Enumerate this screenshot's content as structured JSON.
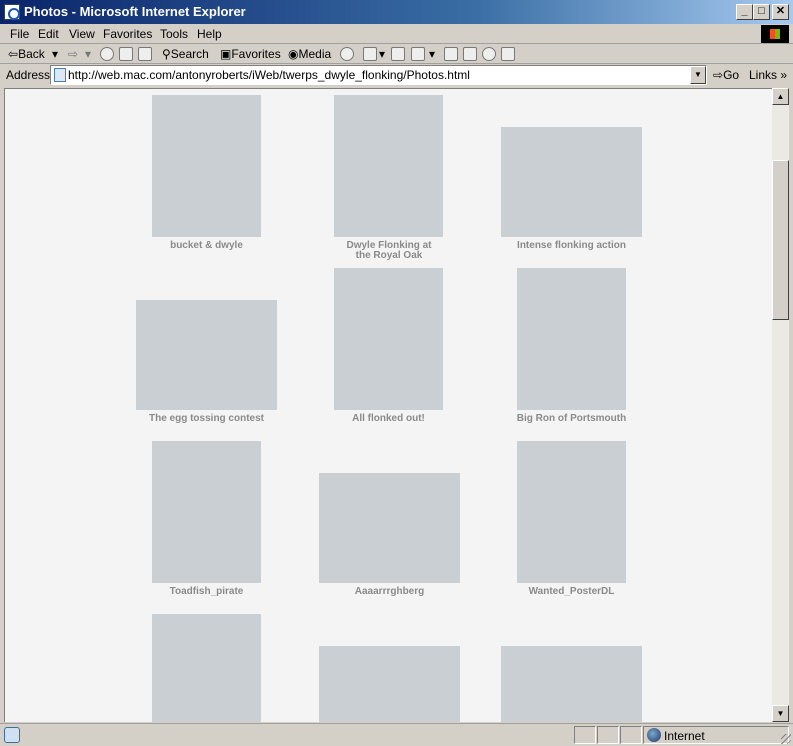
{
  "window": {
    "title": "Photos - Microsoft Internet Explorer",
    "minimize": "_",
    "maximize": "□",
    "close": "✕"
  },
  "menu": [
    {
      "label": "File"
    },
    {
      "label": "Edit"
    },
    {
      "label": "View"
    },
    {
      "label": "Favorites"
    },
    {
      "label": "Tools"
    },
    {
      "label": "Help"
    }
  ],
  "toolbar": {
    "back": "Back",
    "search": "Search",
    "favorites": "Favorites",
    "media": "Media"
  },
  "address": {
    "label": "Address",
    "url": "http://web.mac.com/antonyroberts/iWeb/twerps_dwyle_flonking/Photos.html",
    "go": "Go",
    "links": "Links"
  },
  "photos": [
    {
      "caption": "bucket & dwyle"
    },
    {
      "caption": "Dwyle Flonking at the Royal Oak"
    },
    {
      "caption": "Intense flonking action"
    },
    {
      "caption": "The egg tossing contest"
    },
    {
      "caption": "All flonked out!"
    },
    {
      "caption": "Big Ron of Portsmouth"
    },
    {
      "caption": "Toadfish_pirate"
    },
    {
      "caption": "Aaaarrrghberg"
    },
    {
      "caption": "Wanted_PosterDL"
    },
    {
      "caption": ""
    },
    {
      "caption": ""
    },
    {
      "caption": ""
    }
  ],
  "status": {
    "zone": "Internet"
  }
}
